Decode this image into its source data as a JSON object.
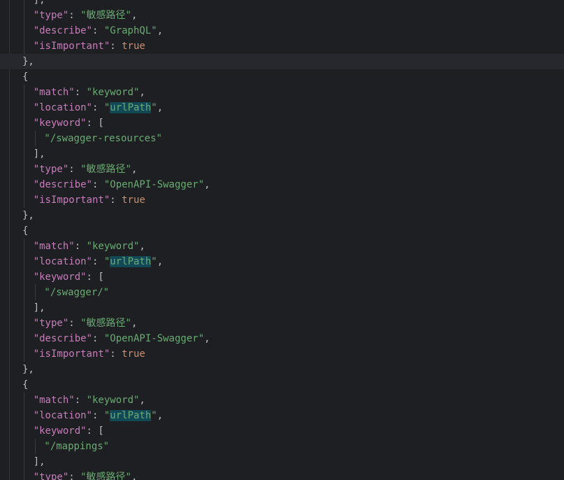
{
  "editor": {
    "lines": [
      {
        "kind": "close-array",
        "text": "],"
      },
      {
        "kind": "pair",
        "key": "\"type\"",
        "value": "\"敏感路径\"",
        "vtype": "string",
        "comma": ","
      },
      {
        "kind": "pair",
        "key": "\"describe\"",
        "value": "\"GraphQL\"",
        "vtype": "string",
        "comma": ","
      },
      {
        "kind": "pair",
        "key": "\"isImportant\"",
        "value": "true",
        "vtype": "bool",
        "comma": ""
      },
      {
        "kind": "close-obj",
        "text": "},"
      },
      {
        "kind": "open-obj",
        "text": "{"
      },
      {
        "kind": "pair",
        "key": "\"match\"",
        "value": "\"keyword\"",
        "vtype": "string",
        "comma": ","
      },
      {
        "kind": "location",
        "key": "\"location\"",
        "q1": "\"",
        "highlight": "urlPath",
        "q2": "\"",
        "comma": ","
      },
      {
        "kind": "open-array",
        "key": "\"keyword\"",
        "text": "["
      },
      {
        "kind": "item",
        "value": "\"/swagger-resources\""
      },
      {
        "kind": "close-array",
        "text": "],"
      },
      {
        "kind": "pair",
        "key": "\"type\"",
        "value": "\"敏感路径\"",
        "vtype": "string",
        "comma": ","
      },
      {
        "kind": "pair",
        "key": "\"describe\"",
        "value": "\"OpenAPI-Swagger\"",
        "vtype": "string",
        "comma": ","
      },
      {
        "kind": "pair",
        "key": "\"isImportant\"",
        "value": "true",
        "vtype": "bool",
        "comma": ""
      },
      {
        "kind": "close-obj",
        "text": "},"
      },
      {
        "kind": "open-obj",
        "text": "{"
      },
      {
        "kind": "pair",
        "key": "\"match\"",
        "value": "\"keyword\"",
        "vtype": "string",
        "comma": ","
      },
      {
        "kind": "location",
        "key": "\"location\"",
        "q1": "\"",
        "highlight": "urlPath",
        "q2": "\"",
        "comma": ","
      },
      {
        "kind": "open-array",
        "key": "\"keyword\"",
        "text": "["
      },
      {
        "kind": "item",
        "value": "\"/swagger/\""
      },
      {
        "kind": "close-array",
        "text": "],"
      },
      {
        "kind": "pair",
        "key": "\"type\"",
        "value": "\"敏感路径\"",
        "vtype": "string",
        "comma": ","
      },
      {
        "kind": "pair",
        "key": "\"describe\"",
        "value": "\"OpenAPI-Swagger\"",
        "vtype": "string",
        "comma": ","
      },
      {
        "kind": "pair",
        "key": "\"isImportant\"",
        "value": "true",
        "vtype": "bool",
        "comma": ""
      },
      {
        "kind": "close-obj",
        "text": "},"
      },
      {
        "kind": "open-obj",
        "text": "{"
      },
      {
        "kind": "pair",
        "key": "\"match\"",
        "value": "\"keyword\"",
        "vtype": "string",
        "comma": ","
      },
      {
        "kind": "location",
        "key": "\"location\"",
        "q1": "\"",
        "highlight": "urlPath",
        "q2": "\"",
        "comma": ","
      },
      {
        "kind": "open-array",
        "key": "\"keyword\"",
        "text": "["
      },
      {
        "kind": "item",
        "value": "\"/mappings\""
      },
      {
        "kind": "close-array",
        "text": "],"
      },
      {
        "kind": "pair",
        "key": "\"type\"",
        "value": "\"敏感路径\"",
        "vtype": "string",
        "comma": ","
      }
    ],
    "current_line": 4,
    "colors": {
      "background": "#1e1f22",
      "key": "#c77dbb",
      "string": "#6aab73",
      "keyword_literal": "#cf8e6d",
      "punctuation": "#bcbec4",
      "search_highlight": "#114957",
      "current_line": "#26282e"
    }
  }
}
